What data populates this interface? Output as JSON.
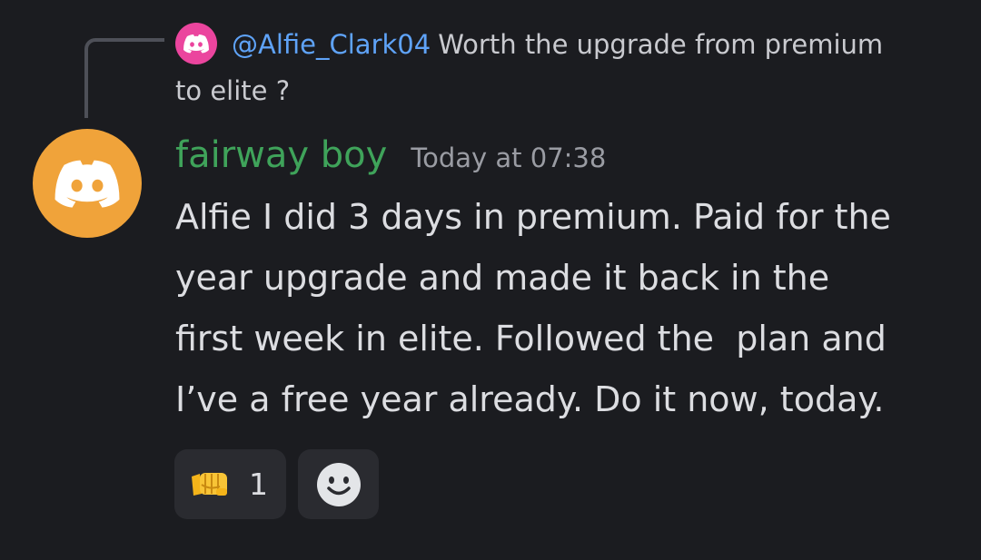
{
  "reply": {
    "mention": "@Alfie_Clark04",
    "text": "Worth the upgrade from premium to elite ?",
    "avatar_color": "#eb459e",
    "avatar_icon": "discord-logo-icon"
  },
  "message": {
    "username": "fairway boy",
    "username_color": "#3fa35a",
    "timestamp": "Today at 07:38",
    "avatar_color": "#f0a33a",
    "avatar_icon": "discord-logo-icon",
    "text": "Alfie I did 3 days in premium. Paid for the\nyear upgrade and made it back in the\nfirst week in elite. Followed the  plan and\nI’ve a free year already. Do it now, today."
  },
  "reactions": [
    {
      "emoji": "fist-bump-icon",
      "count": "1"
    }
  ],
  "add_reaction": {
    "icon": "smiley-icon"
  }
}
